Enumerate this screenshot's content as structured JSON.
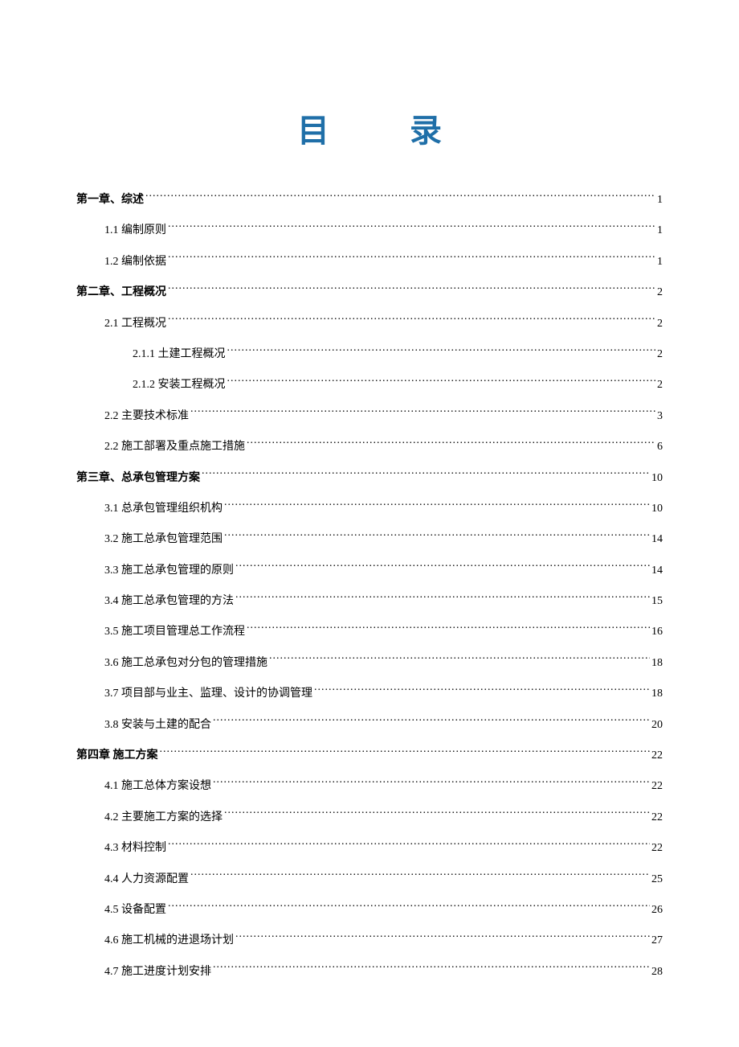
{
  "title": {
    "char1": "目",
    "char2": "录"
  },
  "toc": [
    {
      "level": 0,
      "label": "第一章、综述",
      "page": "1"
    },
    {
      "level": 1,
      "label": "1.1 编制原则",
      "page": "1"
    },
    {
      "level": 1,
      "label": "1.2 编制依据",
      "page": "1"
    },
    {
      "level": 0,
      "label": "第二章、工程概况",
      "page": "2"
    },
    {
      "level": 1,
      "label": "2.1 工程概况",
      "page": "2"
    },
    {
      "level": 2,
      "label": "2.1.1 土建工程概况",
      "page": "2"
    },
    {
      "level": 2,
      "label": "2.1.2 安装工程概况",
      "page": "2"
    },
    {
      "level": 1,
      "label": "2.2 主要技术标准",
      "page": "3"
    },
    {
      "level": 1,
      "label": "2.2  施工部署及重点施工措施",
      "page": "6"
    },
    {
      "level": 0,
      "label": "第三章、总承包管理方案",
      "page": "10"
    },
    {
      "level": 1,
      "label": "3.1 总承包管理组织机构",
      "page": "10"
    },
    {
      "level": 1,
      "label": "3.2  施工总承包管理范围",
      "page": "14"
    },
    {
      "level": 1,
      "label": "3.3  施工总承包管理的原则",
      "page": "14"
    },
    {
      "level": 1,
      "label": "3.4  施工总承包管理的方法",
      "page": "15"
    },
    {
      "level": 1,
      "label": "3.5 施工项目管理总工作流程",
      "page": "16"
    },
    {
      "level": 1,
      "label": "3.6  施工总承包对分包的管理措施",
      "page": "18"
    },
    {
      "level": 1,
      "label": "3.7 项目部与业主、监理、设计的协调管理",
      "page": "18"
    },
    {
      "level": 1,
      "label": "3.8 安装与土建的配合",
      "page": "20"
    },
    {
      "level": 0,
      "label": "第四章  施工方案",
      "page": "22"
    },
    {
      "level": 1,
      "label": "4.1 施工总体方案设想",
      "page": "22"
    },
    {
      "level": 1,
      "label": "4.2  主要施工方案的选择",
      "page": "22"
    },
    {
      "level": 1,
      "label": "4.3 材料控制",
      "page": "22"
    },
    {
      "level": 1,
      "label": "4.4  人力资源配置",
      "page": "25"
    },
    {
      "level": 1,
      "label": "4.5  设备配置",
      "page": "26"
    },
    {
      "level": 1,
      "label": "4.6 施工机械的进退场计划",
      "page": "27"
    },
    {
      "level": 1,
      "label": "4.7  施工进度计划安排",
      "page": "28"
    }
  ]
}
